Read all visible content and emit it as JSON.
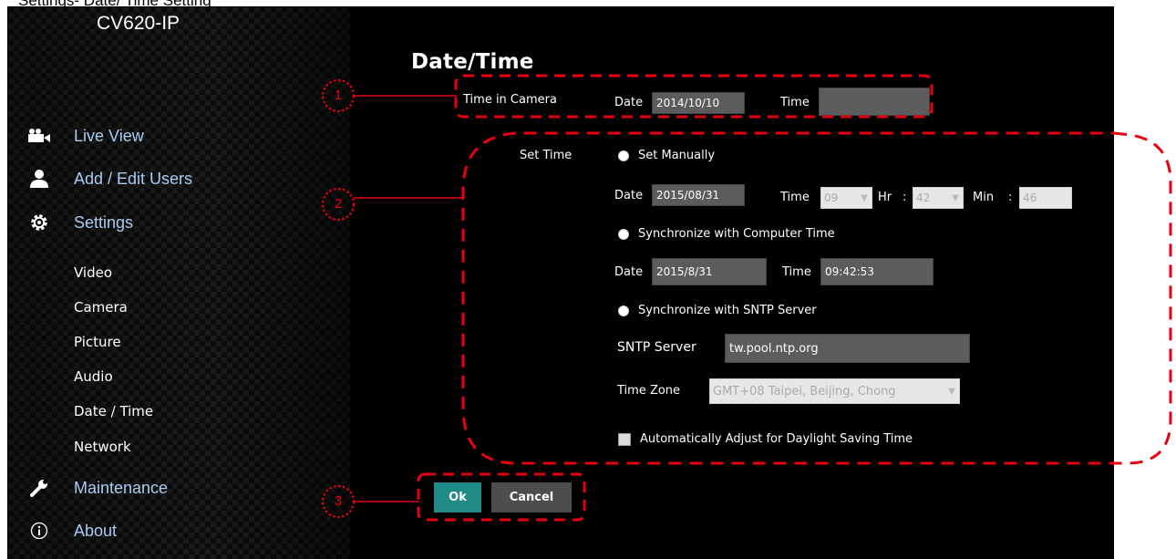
{
  "page_caption": "Settings- Date/ Time Setting",
  "sidebar": {
    "brand": "CV620-IP",
    "main_items": [
      {
        "label": "Live View",
        "icon": "camera-icon"
      },
      {
        "label": "Add / Edit Users",
        "icon": "user-icon"
      },
      {
        "label": "Settings",
        "icon": "gear-icon"
      },
      {
        "label": "Maintenance",
        "icon": "wrench-icon"
      },
      {
        "label": "About",
        "icon": "info-icon"
      }
    ],
    "settings_items": [
      "Video",
      "Camera",
      "Picture",
      "Audio",
      "Date / Time",
      "Network"
    ]
  },
  "main": {
    "title": "Date/Time",
    "time_in_camera": {
      "label": "Time in Camera",
      "date_label": "Date",
      "date_value": "2014/10/10",
      "time_label": "Time",
      "time_value": ""
    },
    "set_time": {
      "label": "Set Time",
      "manual": {
        "label": "Set Manually",
        "date_label": "Date",
        "date_value": "2015/08/31",
        "time_label": "Time",
        "hour_value": "09",
        "hr_label": "Hr",
        "colon": ":",
        "minute_value": "42",
        "min_label": "Min",
        "second_value": "46"
      },
      "sync_computer": {
        "label": "Synchronize with Computer Time",
        "date_label": "Date",
        "date_value": "2015/8/31",
        "time_label": "Time",
        "time_value": "09:42:53"
      },
      "sync_sntp": {
        "label": "Synchronize with SNTP Server",
        "server_label": "SNTP Server",
        "server_value": "tw.pool.ntp.org",
        "timezone_label": "Time Zone",
        "timezone_value": "GMT+08 Taipei, Beijing, Chong"
      },
      "daylight_label": "Automatically Adjust for Daylight Saving Time"
    },
    "ok_label": "Ok",
    "cancel_label": "Cancel"
  },
  "callouts": [
    "1",
    "2",
    "3"
  ],
  "colors": {
    "accent_link": "#a9cdf2",
    "ok_button": "#1f8a86",
    "cancel_button": "#4d4d4d",
    "field_bg": "#5c5c5c",
    "annotation_red": "#e60012"
  }
}
